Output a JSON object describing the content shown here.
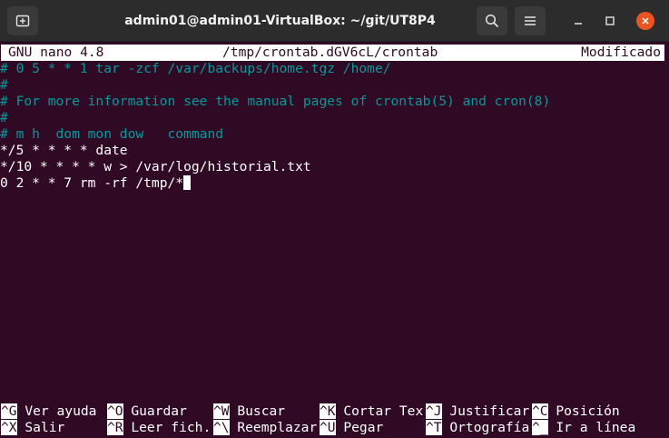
{
  "window": {
    "title": "admin01@admin01-VirtualBox: ~/git/UT8P4"
  },
  "titlebar_icons": {
    "new_tab": "new-tab-icon",
    "search": "search-icon",
    "menu": "hamburger-menu-icon",
    "minimize": "minimize-icon",
    "maximize": "maximize-icon",
    "close": "close-icon"
  },
  "colors": {
    "terminal_background": "#300a24",
    "comment_text": "#06989a",
    "plain_text": "#ffffff",
    "close_button": "#e95420"
  },
  "nano": {
    "version": "GNU nano 4.8",
    "filename": "/tmp/crontab.dGV6cL/crontab",
    "state": "Modificado"
  },
  "editor_lines": [
    {
      "text": "# 0 5 * * 1 tar -zcf /var/backups/home.tgz /home/",
      "style": "comment"
    },
    {
      "text": "#",
      "style": "comment"
    },
    {
      "text": "# For more information see the manual pages of crontab(5) and cron(8)",
      "style": "comment"
    },
    {
      "text": "#",
      "style": "comment"
    },
    {
      "text": "# m h  dom mon dow   command",
      "style": "comment"
    },
    {
      "text": "*/5 * * * * date",
      "style": "plain"
    },
    {
      "text": "*/10 * * * * w > /var/log/historial.txt",
      "style": "plain"
    },
    {
      "text": "0 2 * * 7 rm -rf /tmp/*",
      "style": "plain"
    }
  ],
  "shortcuts": {
    "row1": [
      {
        "key": "^G",
        "label": " Ver ayuda"
      },
      {
        "key": "^O",
        "label": " Guardar"
      },
      {
        "key": "^W",
        "label": " Buscar"
      },
      {
        "key": "^K",
        "label": " Cortar Tex"
      },
      {
        "key": "^J",
        "label": " Justificar"
      },
      {
        "key": "^C",
        "label": " Posición"
      }
    ],
    "row2": [
      {
        "key": "^X",
        "label": " Salir"
      },
      {
        "key": "^R",
        "label": " Leer fich."
      },
      {
        "key": "^\\",
        "label": " Reemplazar"
      },
      {
        "key": "^U",
        "label": " Pegar"
      },
      {
        "key": "^T",
        "label": " Ortografía"
      },
      {
        "key": "^_",
        "label": " Ir a línea"
      }
    ]
  }
}
